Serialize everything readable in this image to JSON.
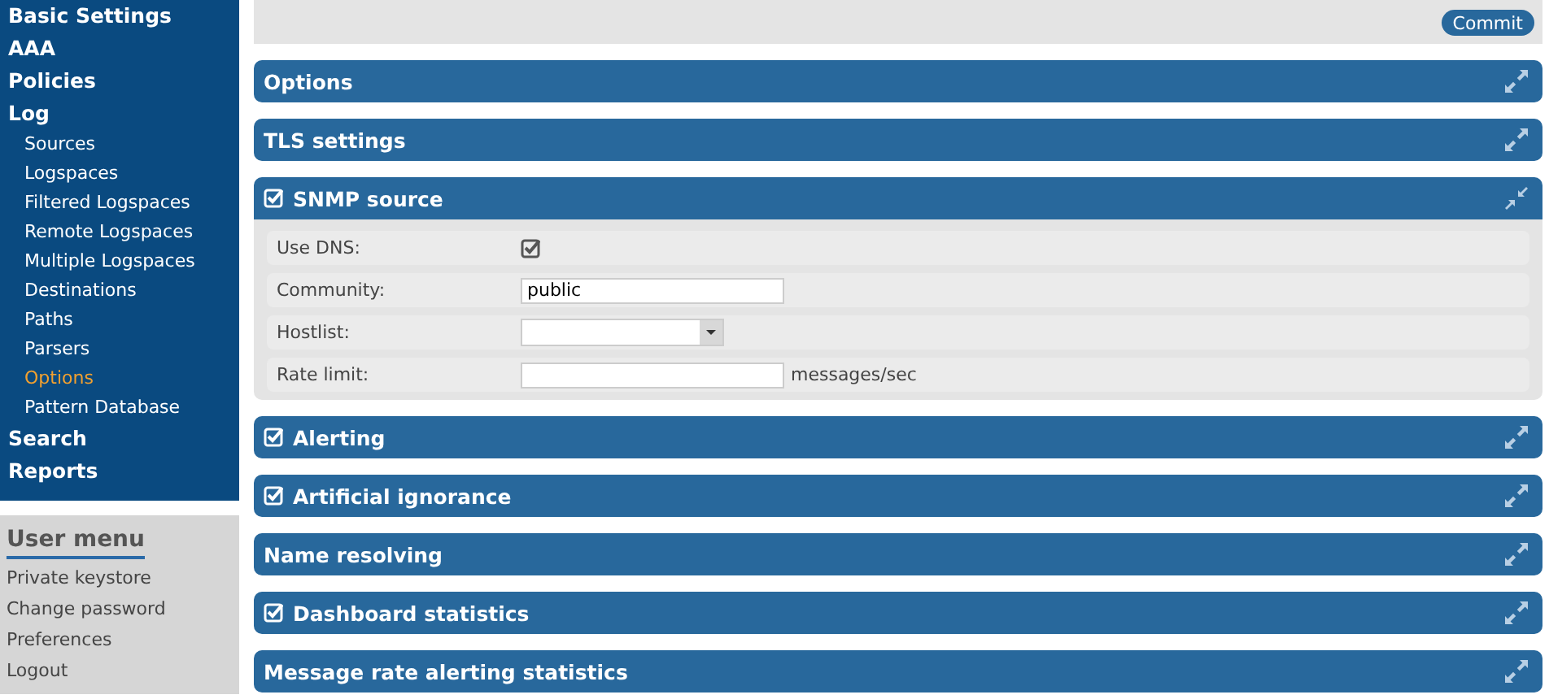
{
  "sidebar": {
    "items": [
      {
        "label": "Basic Settings",
        "selected": false
      },
      {
        "label": "AAA",
        "selected": false
      },
      {
        "label": "Policies",
        "selected": false
      },
      {
        "label": "Log",
        "selected": false,
        "children": [
          {
            "label": "Sources",
            "selected": false
          },
          {
            "label": "Logspaces",
            "selected": false
          },
          {
            "label": "Filtered Logspaces",
            "selected": false
          },
          {
            "label": "Remote Logspaces",
            "selected": false
          },
          {
            "label": "Multiple Logspaces",
            "selected": false
          },
          {
            "label": "Destinations",
            "selected": false
          },
          {
            "label": "Paths",
            "selected": false
          },
          {
            "label": "Parsers",
            "selected": false
          },
          {
            "label": "Options",
            "selected": true
          },
          {
            "label": "Pattern Database",
            "selected": false
          }
        ]
      },
      {
        "label": "Search",
        "selected": false
      },
      {
        "label": "Reports",
        "selected": false
      }
    ]
  },
  "user_menu": {
    "title": "User menu",
    "items": [
      "Private keystore",
      "Change password",
      "Preferences",
      "Logout"
    ]
  },
  "toolbar": {
    "button": "Commit"
  },
  "panels": [
    {
      "title": "Options",
      "kind": "plain",
      "expanded": false
    },
    {
      "title": "TLS settings",
      "kind": "plain",
      "expanded": false
    },
    {
      "title": "SNMP source",
      "kind": "toggle",
      "checked": true,
      "expanded": true,
      "fields": [
        {
          "label": "Use DNS:",
          "kind": "checkbox",
          "checked": true
        },
        {
          "label": "Community:",
          "kind": "text",
          "value": "public"
        },
        {
          "label": "Hostlist:",
          "kind": "select"
        },
        {
          "label": "Rate limit:",
          "kind": "text",
          "unit": "messages/sec"
        }
      ]
    },
    {
      "title": "Alerting",
      "kind": "toggle",
      "checked": true,
      "expanded": false
    },
    {
      "title": "Artificial ignorance",
      "kind": "toggle",
      "checked": true,
      "expanded": false
    },
    {
      "title": "Name resolving",
      "kind": "plain",
      "expanded": false
    },
    {
      "title": "Dashboard statistics",
      "kind": "toggle",
      "checked": true,
      "expanded": false
    },
    {
      "title": "Message rate alerting statistics",
      "kind": "plain",
      "expanded": false
    }
  ]
}
